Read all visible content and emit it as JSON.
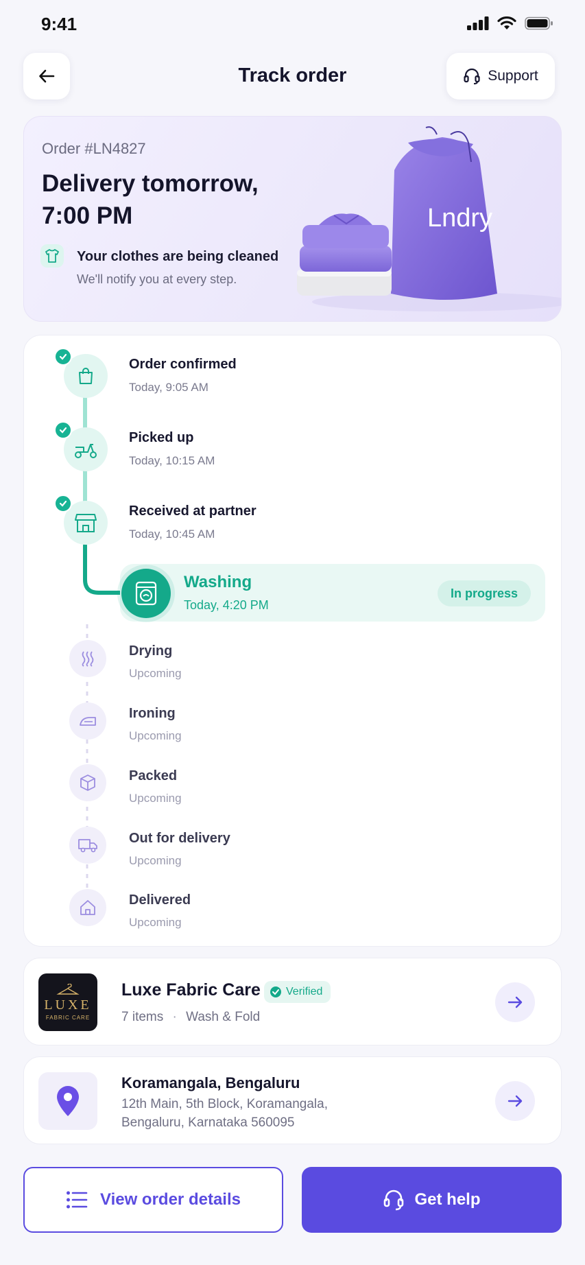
{
  "status_bar": {
    "time": "9:41"
  },
  "header": {
    "title": "Track order",
    "support_label": "Support"
  },
  "hero": {
    "order_id": "Order #LN4827",
    "delivery_heading": "Delivery tomorrow, 7:00 PM",
    "status_title": "Your clothes are being cleaned",
    "status_sub": "We'll notify you at every step.",
    "bag_brand": "Lndry"
  },
  "timeline": {
    "completed": [
      {
        "title": "Order confirmed",
        "time": "Today, 9:05 AM",
        "icon": "shopping-bag-icon"
      },
      {
        "title": "Picked up",
        "time": "Today, 10:15 AM",
        "icon": "scooter-icon"
      },
      {
        "title": "Received at partner",
        "time": "Today, 10:45 AM",
        "icon": "store-icon"
      }
    ],
    "current": {
      "title": "Washing",
      "time": "Today, 4:20 PM",
      "badge": "In progress",
      "icon": "washing-machine-icon"
    },
    "upcoming": [
      {
        "title": "Drying",
        "time": "Upcoming",
        "icon": "steam-icon"
      },
      {
        "title": "Ironing",
        "time": "Upcoming",
        "icon": "iron-icon"
      },
      {
        "title": "Packed",
        "time": "Upcoming",
        "icon": "box-icon"
      },
      {
        "title": "Out for delivery",
        "time": "Upcoming",
        "icon": "truck-icon"
      },
      {
        "title": "Delivered",
        "time": "Upcoming",
        "icon": "home-icon"
      }
    ]
  },
  "partner": {
    "logo_main": "LUXE",
    "logo_sub": "FABRIC CARE",
    "name": "Luxe Fabric Care",
    "verified_label": "Verified",
    "items": "7 items",
    "service": "Wash & Fold"
  },
  "address": {
    "title": "Koramangala, Bengaluru",
    "line1": "12th Main, 5th Block, Koramangala,",
    "line2": "Bengaluru, Karnataka 560095"
  },
  "actions": {
    "view_details": "View order details",
    "get_help": "Get help"
  },
  "colors": {
    "accent": "#5A4BE0",
    "teal": "#14A98A",
    "background": "#F6F6FB"
  }
}
